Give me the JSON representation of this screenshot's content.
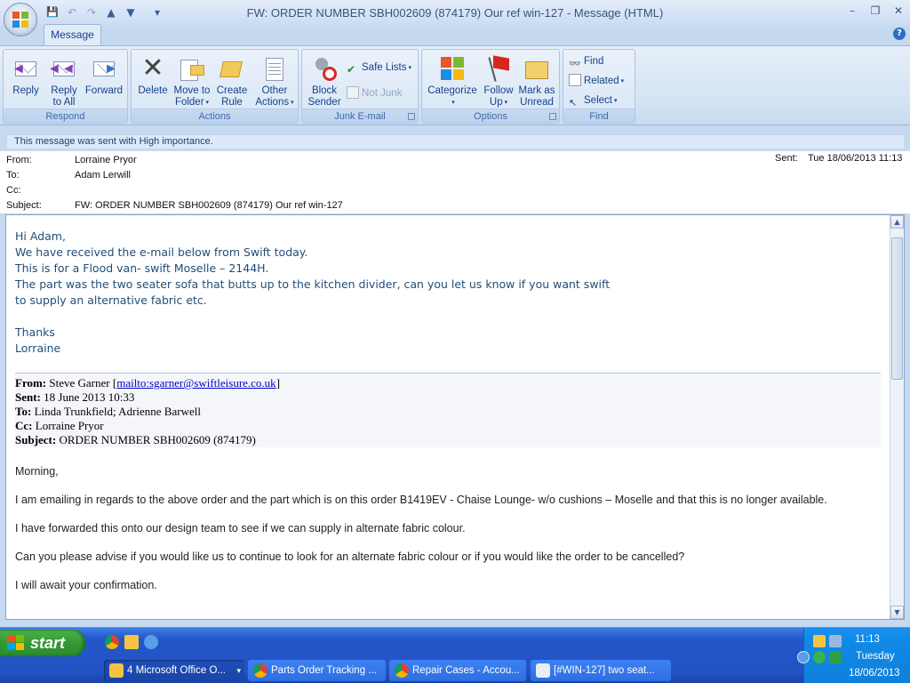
{
  "window": {
    "title": "FW: ORDER NUMBER SBH002609 (874179)   Our ref win-127 - Message (HTML)",
    "controls": {
      "minimize": "–",
      "restore": "❐",
      "close": "✕"
    }
  },
  "quick_access": {
    "save": "💾",
    "undo": "↶",
    "redo": "↷",
    "prev": "▲",
    "next": "▼",
    "customize": "▾"
  },
  "tabs": {
    "message": "Message",
    "help": "?"
  },
  "ribbon": {
    "respond": {
      "label": "Respond",
      "reply": "Reply",
      "reply_all_1": "Reply",
      "reply_all_2": "to All",
      "forward": "Forward"
    },
    "actions": {
      "label": "Actions",
      "delete": "Delete",
      "move_1": "Move to",
      "move_2": "Folder",
      "create_1": "Create",
      "create_2": "Rule",
      "other_1": "Other",
      "other_2": "Actions"
    },
    "junk": {
      "label": "Junk E-mail",
      "block_1": "Block",
      "block_2": "Sender",
      "safe_lists": "Safe Lists",
      "not_junk": "Not Junk"
    },
    "options": {
      "label": "Options",
      "categorize": "Categorize",
      "follow_1": "Follow",
      "follow_2": "Up",
      "mark_1": "Mark as",
      "mark_2": "Unread"
    },
    "find": {
      "label": "Find",
      "find": "Find",
      "related": "Related",
      "select": "Select"
    }
  },
  "infobar": "This message was sent with High importance.",
  "header": {
    "from_label": "From:",
    "from": "Lorraine Pryor",
    "to_label": "To:",
    "to": "Adam Lerwill",
    "cc_label": "Cc:",
    "cc": "",
    "subject_label": "Subject:",
    "subject": "FW: ORDER NUMBER SBH002609 (874179)   Our ref win-127",
    "sent_label": "Sent:",
    "sent": "Tue 18/06/2013 11:13"
  },
  "body": {
    "lines": [
      "Hi Adam,",
      "We have received the e-mail below from Swift today.",
      "This is for a Flood van- swift Moselle – 2144H.",
      "The part was the two seater sofa that butts up to the kitchen divider, can you let us know if you want swift",
      "to supply an alternative fabric etc."
    ],
    "thanks": "Thanks",
    "signature": "Lorraine"
  },
  "forwarded": {
    "from_label": "From:",
    "from_name": "Steve Garner",
    "from_link": "mailto:sgarner@swiftleisure.co.uk",
    "sent_label": "Sent:",
    "sent": "18 June 2013 10:33",
    "to_label": "To:",
    "to": "Linda Trunkfield; Adrienne Barwell",
    "cc_label": "Cc:",
    "cc": "Lorraine Pryor",
    "subject_label": "Subject:",
    "subject": "ORDER NUMBER SBH002609 (874179)",
    "greeting": "Morning,",
    "p1": "I am emailing in regards to the above order and the part which is on this order B1419EV - Chaise Lounge- w/o cushions – Moselle and that this is no longer available.",
    "p2": "I have forwarded this onto our design team to see if we can supply in alternate fabric colour.",
    "p3": "Can you please advise if you would like us to continue to look for an alternate fabric colour or if you would like the order to be cancelled?",
    "p4": "I will await your confirmation."
  },
  "taskbar": {
    "start": "start",
    "tasks": [
      {
        "label": "4 Microsoft Office O...",
        "color": "#3c81f3"
      },
      {
        "label": "Parts Order Tracking ...",
        "color": "#3c81f3"
      },
      {
        "label": "Repair Cases - Accou...",
        "color": "#3c81f3"
      },
      {
        "label": "[#WIN-127] two seat...",
        "color": "#3c81f3"
      }
    ],
    "group_arrow": "▾",
    "clock_time": "11:13",
    "clock_day": "Tuesday",
    "clock_date": "18/06/2013"
  }
}
